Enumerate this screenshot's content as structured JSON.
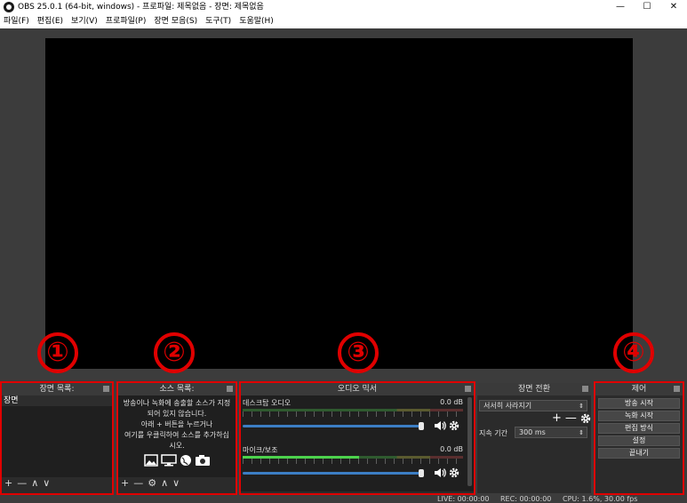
{
  "window": {
    "title": "OBS 25.0.1 (64-bit, windows) - 프로파일: 제목없음 - 장면: 제목없음",
    "minimize": "—",
    "maximize": "☐",
    "close": "✕"
  },
  "menu": [
    "파일(F)",
    "편집(E)",
    "보기(V)",
    "프로파일(P)",
    "장면 모음(S)",
    "도구(T)",
    "도움말(H)"
  ],
  "scenes": {
    "title": "장면 목록:",
    "items": [
      "장면"
    ],
    "toolbar": [
      "+",
      "—",
      "∧",
      "∨"
    ]
  },
  "sources": {
    "title": "소스 목록:",
    "message": [
      "방송이나 녹화에 송출할 소스가 지정",
      "되어 있지 않습니다.",
      "아래 + 버튼을 누르거나",
      "여기를 우클릭하여 소스를 추가하십",
      "시오."
    ],
    "icons": [
      "image-icon",
      "monitor-icon",
      "globe-icon",
      "camera-icon"
    ],
    "toolbar": [
      "+",
      "—",
      "⚙",
      "∧",
      "∨"
    ]
  },
  "mixer": {
    "title": "오디오 믹서",
    "tracks": [
      {
        "name": "데스크탑 오디오",
        "db": "0.0 dB",
        "level": 0.0,
        "volume": 0.96
      },
      {
        "name": "마이크/보조",
        "db": "0.0 dB",
        "level": 0.53,
        "volume": 0.96
      }
    ]
  },
  "transitions": {
    "title": "장면 전환",
    "selected": "서서히 사라지기",
    "duration_label": "지속 기간",
    "duration_value": "300 ms"
  },
  "controls": {
    "title": "제어",
    "buttons": [
      "방송 시작",
      "녹화 시작",
      "편집 방식",
      "설정",
      "끝내기"
    ]
  },
  "annotations": [
    "①",
    "②",
    "③",
    "④"
  ],
  "status": {
    "live": "LIVE: 00:00:00",
    "rec": "REC: 00:00:00",
    "cpu": "CPU: 1.6%, 30.00 fps"
  },
  "colors": {
    "highlight": "#e00000",
    "meter_green": "#4cd24c",
    "volume_blue": "#3c7ec4"
  }
}
